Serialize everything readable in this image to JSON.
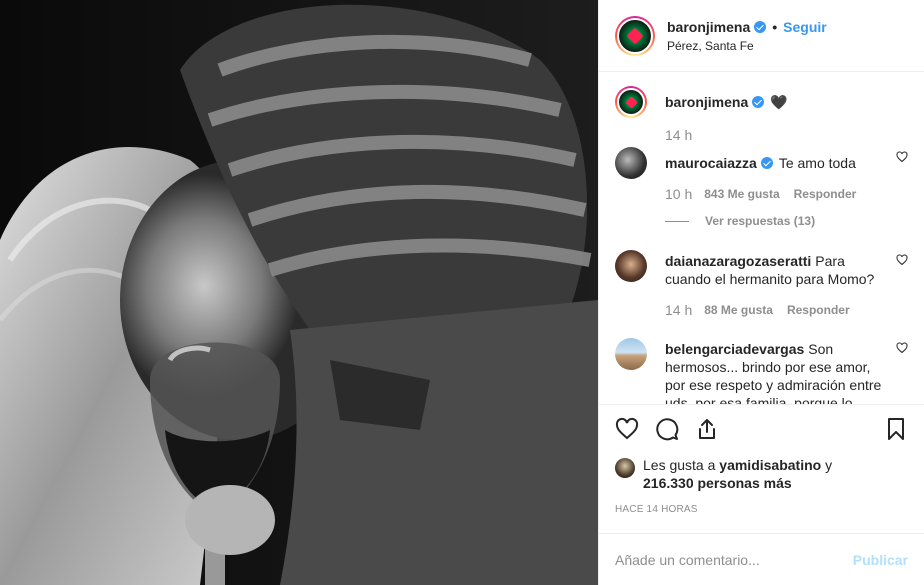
{
  "post": {
    "username": "baronjimena",
    "separator": "•",
    "follow_label": "Seguir",
    "location": "Pérez, Santa Fe"
  },
  "caption": {
    "username": "baronjimena",
    "emoji": "🖤",
    "time": "14 h"
  },
  "comments": [
    {
      "username": "maurocaiazza",
      "verified": true,
      "text": "Te amo toda",
      "time": "10 h",
      "likes": "843 Me gusta",
      "reply": "Responder",
      "view_replies": "Ver respuestas (13)"
    },
    {
      "username": "daianazaragozaseratti",
      "text": "Para cuando el hermanito para Momo?",
      "time": "14 h",
      "likes": "88 Me gusta",
      "reply": "Responder"
    },
    {
      "username": "belengarciadevargas",
      "text": "Son hermosos... brindo por ese amor, por ese respeto y admiración entre uds, por esa familia, porque lo son... fui la tonta, mucho"
    }
  ],
  "likes": {
    "prefix": "Les gusta a",
    "user": "yamidisabatino",
    "conj": "y",
    "count": "216.330 personas más"
  },
  "timestamp": "HACE 14 HORAS",
  "add_comment": {
    "placeholder": "Añade un comentario...",
    "publish": "Publicar"
  },
  "icons": {
    "like": "heart-icon",
    "comment": "comment-icon",
    "share": "share-icon",
    "save": "bookmark-icon"
  },
  "colors": {
    "link": "#3897f0",
    "publish_disabled": "#b2dffc",
    "muted": "#8e8e8e"
  }
}
